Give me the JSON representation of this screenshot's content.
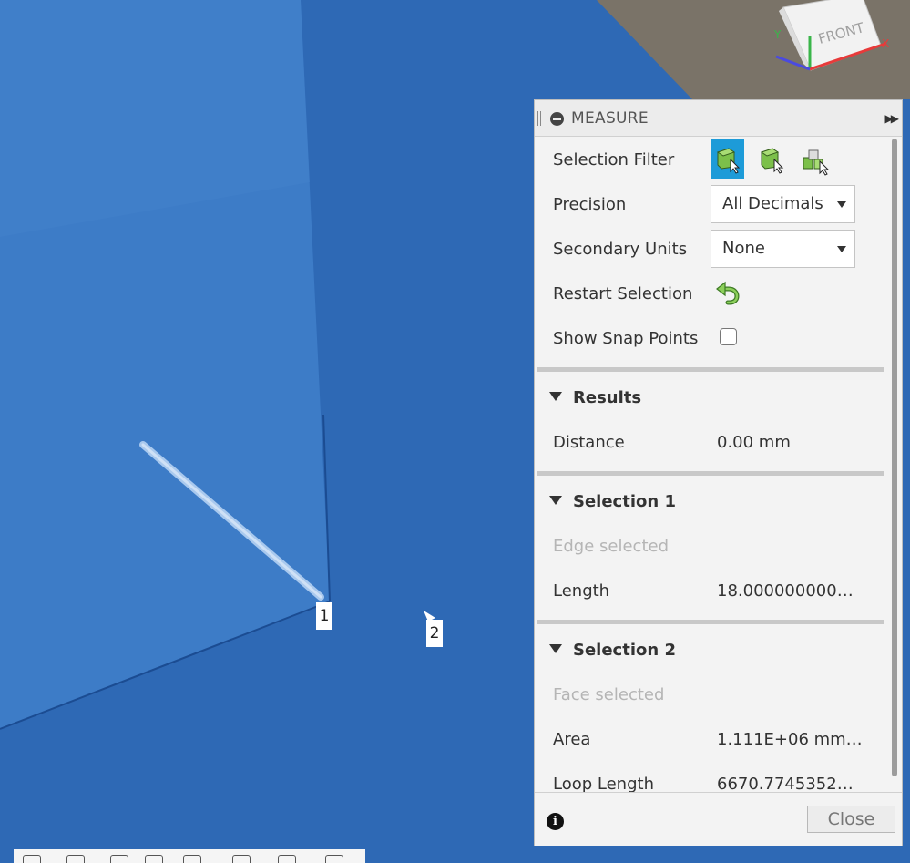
{
  "panel": {
    "title": "MEASURE",
    "selection_filter_label": "Selection Filter",
    "precision_label": "Precision",
    "precision_value": "All Decimals",
    "secondary_units_label": "Secondary Units",
    "secondary_units_value": "None",
    "restart_selection_label": "Restart Selection",
    "show_snap_points_label": "Show Snap Points",
    "results": {
      "header": "Results",
      "distance_label": "Distance",
      "distance_value": "0.00 mm"
    },
    "selection1": {
      "header": "Selection 1",
      "status": "Edge selected",
      "length_label": "Length",
      "length_value": "18.000000000…"
    },
    "selection2": {
      "header": "Selection 2",
      "status": "Face selected",
      "area_label": "Area",
      "area_value": "1.111E+06 mm…",
      "loop_length_label": "Loop Length",
      "loop_length_value": "6670.7745352…"
    },
    "close_label": "Close"
  },
  "viewport": {
    "marker1": "1",
    "marker2": "2",
    "viewcube_label": "FRONT"
  },
  "colors": {
    "accent": "#1d9bd8",
    "model_face": "#2e69b5",
    "model_face_light": "#3d7cc7",
    "background": "#7a7368"
  }
}
